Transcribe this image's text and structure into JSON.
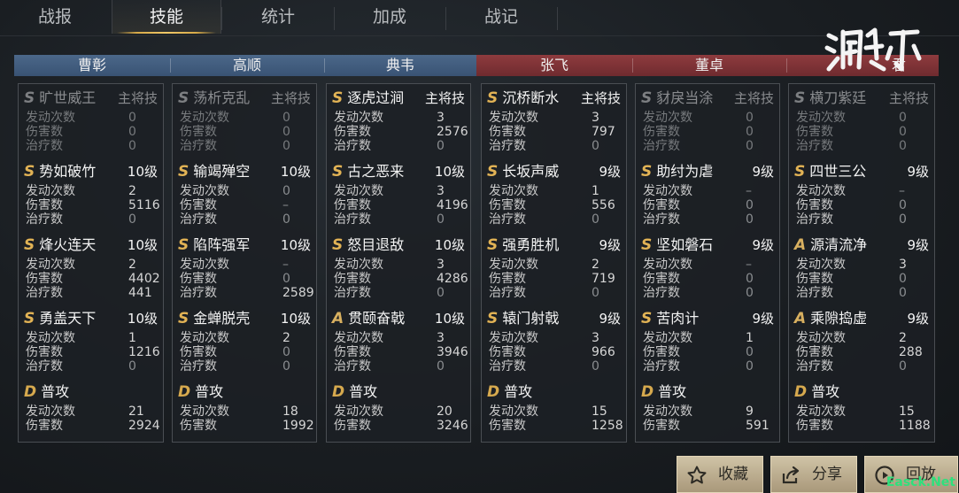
{
  "tabs": [
    {
      "label": "战报"
    },
    {
      "label": "技能"
    },
    {
      "label": "统计"
    },
    {
      "label": "加成"
    },
    {
      "label": "战记"
    }
  ],
  "stat_labels": {
    "uses": "发动次数",
    "damage": "伤害数",
    "heal": "治疗数"
  },
  "generals": [
    {
      "name": "曹彰",
      "side": "blue",
      "skills": [
        {
          "grade": "S",
          "name": "旷世威王",
          "level": "主将技",
          "uses": "0",
          "damage": "0",
          "heal": "0",
          "dim": true
        },
        {
          "grade": "S",
          "name": "势如破竹",
          "level": "10级",
          "uses": "2",
          "damage": "5116",
          "heal": "0"
        },
        {
          "grade": "S",
          "name": "烽火连天",
          "level": "10级",
          "uses": "2",
          "damage": "4402",
          "heal": "441"
        },
        {
          "grade": "S",
          "name": "勇盖天下",
          "level": "10级",
          "uses": "1",
          "damage": "1216",
          "heal": "0"
        },
        {
          "grade": "D",
          "name": "普攻",
          "level": "",
          "uses": "21",
          "damage": "2924"
        }
      ]
    },
    {
      "name": "高顺",
      "side": "blue",
      "skills": [
        {
          "grade": "S",
          "name": "荡析克乱",
          "level": "主将技",
          "uses": "0",
          "damage": "0",
          "heal": "0",
          "dim": true
        },
        {
          "grade": "S",
          "name": "输竭殚空",
          "level": "10级",
          "uses": "0",
          "damage": "–",
          "heal": "0"
        },
        {
          "grade": "S",
          "name": "陷阵强军",
          "level": "10级",
          "uses": "–",
          "damage": "0",
          "heal": "2589"
        },
        {
          "grade": "S",
          "name": "金蝉脱壳",
          "level": "10级",
          "uses": "2",
          "damage": "0",
          "heal": "0"
        },
        {
          "grade": "D",
          "name": "普攻",
          "level": "",
          "uses": "18",
          "damage": "1992"
        }
      ]
    },
    {
      "name": "典韦",
      "side": "blue",
      "skills": [
        {
          "grade": "S",
          "name": "逐虎过涧",
          "level": "主将技",
          "uses": "3",
          "damage": "2576",
          "heal": "0"
        },
        {
          "grade": "S",
          "name": "古之恶来",
          "level": "10级",
          "uses": "3",
          "damage": "4196",
          "heal": "0"
        },
        {
          "grade": "S",
          "name": "怒目退敌",
          "level": "10级",
          "uses": "3",
          "damage": "4286",
          "heal": "0"
        },
        {
          "grade": "A",
          "name": "贯颐奋戟",
          "level": "10级",
          "uses": "3",
          "damage": "3946",
          "heal": "0"
        },
        {
          "grade": "D",
          "name": "普攻",
          "level": "",
          "uses": "20",
          "damage": "3246"
        }
      ]
    },
    {
      "name": "张飞",
      "side": "red",
      "skills": [
        {
          "grade": "S",
          "name": "沉桥断水",
          "level": "主将技",
          "uses": "3",
          "damage": "797",
          "heal": "0"
        },
        {
          "grade": "S",
          "name": "长坂声威",
          "level": "9级",
          "uses": "1",
          "damage": "556",
          "heal": "0"
        },
        {
          "grade": "S",
          "name": "强勇胜机",
          "level": "9级",
          "uses": "2",
          "damage": "719",
          "heal": "0"
        },
        {
          "grade": "S",
          "name": "辕门射戟",
          "level": "9级",
          "uses": "3",
          "damage": "966",
          "heal": "0"
        },
        {
          "grade": "D",
          "name": "普攻",
          "level": "",
          "uses": "15",
          "damage": "1258"
        }
      ]
    },
    {
      "name": "董卓",
      "side": "red",
      "skills": [
        {
          "grade": "S",
          "name": "豺戾当涂",
          "level": "主将技",
          "uses": "0",
          "damage": "0",
          "heal": "0",
          "dim": true
        },
        {
          "grade": "S",
          "name": "助纣为虐",
          "level": "9级",
          "uses": "–",
          "damage": "0",
          "heal": "0"
        },
        {
          "grade": "S",
          "name": "坚如磐石",
          "level": "9级",
          "uses": "–",
          "damage": "0",
          "heal": "0"
        },
        {
          "grade": "S",
          "name": "苦肉计",
          "level": "9级",
          "uses": "1",
          "damage": "0",
          "heal": "0"
        },
        {
          "grade": "D",
          "name": "普攻",
          "level": "",
          "uses": "9",
          "damage": "591"
        }
      ]
    },
    {
      "name": "君",
      "side": "red",
      "skills": [
        {
          "grade": "S",
          "name": "横刀紫廷",
          "level": "主将技",
          "uses": "0",
          "damage": "0",
          "heal": "0",
          "dim": true
        },
        {
          "grade": "S",
          "name": "四世三公",
          "level": "9级",
          "uses": "–",
          "damage": "0",
          "heal": "0"
        },
        {
          "grade": "A",
          "name": "源清流净",
          "level": "9级",
          "uses": "3",
          "damage": "0",
          "heal": "0"
        },
        {
          "grade": "A",
          "name": "乘隙捣虚",
          "level": "9级",
          "uses": "2",
          "damage": "288",
          "heal": "0"
        },
        {
          "grade": "D",
          "name": "普攻",
          "level": "",
          "uses": "15",
          "damage": "1188"
        }
      ]
    }
  ],
  "buttons": {
    "favorite": "收藏",
    "share": "分享",
    "replay": "回放"
  },
  "watermark": "Easck.Net",
  "colors": {
    "blue_header": "#4b6789",
    "red_header": "#8e3b3e",
    "gold": "#e2b355",
    "button": "#cfc3a6"
  }
}
